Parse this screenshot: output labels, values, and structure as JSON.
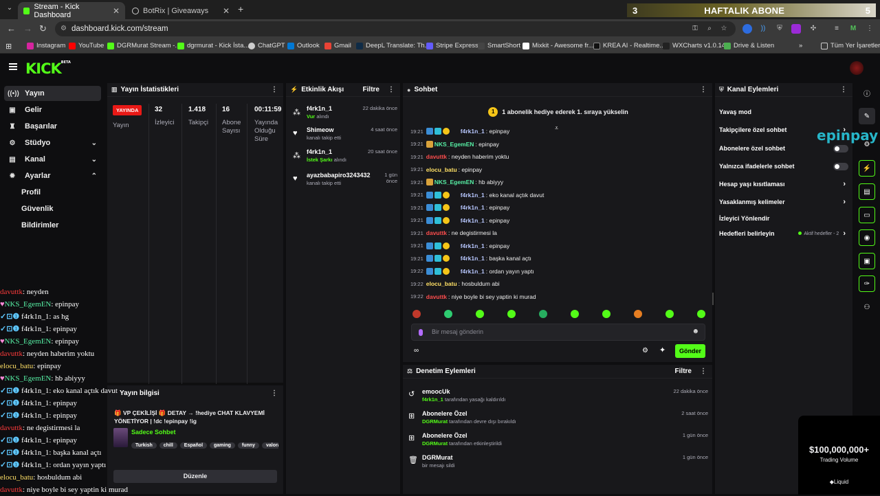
{
  "browser": {
    "tabs": [
      {
        "title": "Stream - Kick Dashboard",
        "active": true
      },
      {
        "title": "BotRix | Giveaways",
        "active": false
      }
    ],
    "url": "dashboard.kick.com/stream",
    "overlay_banner": {
      "left": "3",
      "title": "HAFTALIK ABONE",
      "right": "5"
    },
    "bookmarks": [
      "Instagram",
      "YouTube",
      "DGRMurat Stream -...",
      "dgrmurat - Kick İsta...",
      "ChatGPT",
      "Outlook",
      "Gmail",
      "DeepL Translate: Th...",
      "Stripe Express",
      "SmartShort",
      "Mixkit - Awesome fr...",
      "KREA AI - Realtime...",
      "WXCharts v1.0.14",
      "Drive & Listen"
    ],
    "bookmarks_folder": "Tüm Yer İşaretleri",
    "profile_initial": "M"
  },
  "kick": {
    "logo": "KICK",
    "logo_tag": "BETA"
  },
  "sidebar": {
    "items": [
      {
        "label": "Yayın",
        "icon": "broadcast-icon",
        "selected": true
      },
      {
        "label": "Gelir",
        "icon": "wallet-icon"
      },
      {
        "label": "Başarılar",
        "icon": "trophy-icon"
      },
      {
        "label": "Stüdyo",
        "icon": "studio-icon",
        "chevron": "down"
      },
      {
        "label": "Kanal",
        "icon": "channel-icon",
        "chevron": "down"
      },
      {
        "label": "Ayarlar",
        "icon": "gear-icon",
        "chevron": "up"
      }
    ],
    "sub_items": [
      "Profil",
      "Güvenlik",
      "Bildirimler"
    ]
  },
  "overlay_chat": [
    {
      "user": "davuttk",
      "color": "r",
      "text": "neyden"
    },
    {
      "user": "NKS_EgemEN",
      "color": "p",
      "badge": "heart",
      "text": "epinpay"
    },
    {
      "user": "f4rk1n_1",
      "color": "u",
      "badge": "bd",
      "text": "as hg"
    },
    {
      "user": "f4rk1n_1",
      "color": "u",
      "badge": "bd",
      "text": "epinpay"
    },
    {
      "user": "NKS_EgemEN",
      "color": "p",
      "badge": "heart",
      "text": "epinpay"
    },
    {
      "user": "davuttk",
      "color": "r",
      "text": "neyden haberim yoktu"
    },
    {
      "user": "elocu_batu",
      "color": "y",
      "text": "epinpay"
    },
    {
      "user": "NKS_EgemEN",
      "color": "p",
      "badge": "heart",
      "text": "hb abiyyy"
    },
    {
      "user": "f4rk1n_1",
      "color": "u",
      "badge": "bd",
      "text": "eko kanal açtık davut"
    },
    {
      "user": "f4rk1n_1",
      "color": "u",
      "badge": "bd",
      "text": "epinpay"
    },
    {
      "user": "f4rk1n_1",
      "color": "u",
      "badge": "bd",
      "text": "epinpay"
    },
    {
      "user": "davuttk",
      "color": "r",
      "text": "ne degistirmesi la"
    },
    {
      "user": "f4rk1n_1",
      "color": "u",
      "badge": "bd",
      "text": "epinpay"
    },
    {
      "user": "f4rk1n_1",
      "color": "u",
      "badge": "bd",
      "text": "başka kanal açtı"
    },
    {
      "user": "f4rk1n_1",
      "color": "u",
      "badge": "bd",
      "text": "ordan yayın yaptı"
    },
    {
      "user": "elocu_batu",
      "color": "y",
      "text": "hosbuldum abi"
    },
    {
      "user": "davuttk",
      "color": "r",
      "text": "niye boyle bi sey yaptin ki murad"
    }
  ],
  "stats": {
    "title": "Yayın İstatistikleri",
    "live_label": "YAYINDA",
    "columns": [
      {
        "value": "",
        "label": "Yayın"
      },
      {
        "value": "32",
        "label": "İzleyici"
      },
      {
        "value": "1.418",
        "label": "Takipçi"
      },
      {
        "value": "16",
        "label": "Abone Sayısı"
      },
      {
        "value": "00:11:59",
        "label": "Yayında Olduğu Süre"
      }
    ]
  },
  "stream_info": {
    "title": "Yayın bilgisi",
    "stream_title": "🎁 VP ÇEKİLİŞİ 🎁 DETAY → !hediye CHAT KLAVYEMİ YÖNETİYOR | !dc !epinpay !ig",
    "mode": "Sadece Sohbet",
    "tags": [
      "Turkish",
      "chill",
      "Español",
      "gaming",
      "funny",
      "valorant"
    ],
    "edit_button": "Düzenle"
  },
  "events": {
    "title": "Etkinlik Akışı",
    "filter": "Filtre",
    "items": [
      {
        "user": "f4rk1n_1",
        "highlight": "Vur",
        "desc": " alındı",
        "time": "22 dakika önce",
        "icon": "gift-icon"
      },
      {
        "user": "Shimeow",
        "highlight": "",
        "desc": "kanalı takip etti",
        "time": "4 saat önce",
        "icon": "heart-icon"
      },
      {
        "user": "f4rk1n_1",
        "highlight": "İstek Şarkı",
        "desc": " alındı",
        "time": "20 saat önce",
        "icon": "gift-icon"
      },
      {
        "user": "ayazbabapiro3243432",
        "highlight": "",
        "desc": "kanalı takip etti",
        "time": "1 gün önce",
        "icon": "heart-icon"
      }
    ]
  },
  "chat": {
    "title": "Sohbet",
    "banner": "1 abonelik hediye ederek 1. sıraya yükselin",
    "banner_rank": "1",
    "messages": [
      {
        "time": "19:21",
        "user": "f4rk1n_1",
        "color": "#b8c7ff",
        "badges": [
          "b1",
          "b2",
          "b3"
        ],
        "text": "epinpay"
      },
      {
        "time": "19:21",
        "user": "NKS_EgemEN",
        "color": "#57f0a5",
        "badges": [
          "b4"
        ],
        "text": "epinpay"
      },
      {
        "time": "19:21",
        "user": "davuttk",
        "color": "#ff4d4d",
        "badges": [],
        "text": "neyden haberim yoktu"
      },
      {
        "time": "19:21",
        "user": "elocu_batu",
        "color": "#ffe066",
        "badges": [],
        "text": "epinpay"
      },
      {
        "time": "19:21",
        "user": "NKS_EgemEN",
        "color": "#57f0a5",
        "badges": [
          "b4"
        ],
        "text": "hb abiyyy"
      },
      {
        "time": "19:21",
        "user": "f4rk1n_1",
        "color": "#b8c7ff",
        "badges": [
          "b1",
          "b2",
          "b3"
        ],
        "text": "eko kanal açtık davut"
      },
      {
        "time": "19:21",
        "user": "f4rk1n_1",
        "color": "#b8c7ff",
        "badges": [
          "b1",
          "b2",
          "b3"
        ],
        "text": "epinpay"
      },
      {
        "time": "19:21",
        "user": "f4rk1n_1",
        "color": "#b8c7ff",
        "badges": [
          "b1",
          "b2",
          "b3"
        ],
        "text": "epinpay"
      },
      {
        "time": "19:21",
        "user": "davuttk",
        "color": "#ff4d4d",
        "badges": [],
        "text": "ne degistirmesi la"
      },
      {
        "time": "19:21",
        "user": "f4rk1n_1",
        "color": "#b8c7ff",
        "badges": [
          "b1",
          "b2",
          "b3"
        ],
        "text": "epinpay"
      },
      {
        "time": "19:21",
        "user": "f4rk1n_1",
        "color": "#b8c7ff",
        "badges": [
          "b1",
          "b2",
          "b3"
        ],
        "text": "başka kanal açtı"
      },
      {
        "time": "19:22",
        "user": "f4rk1n_1",
        "color": "#b8c7ff",
        "badges": [
          "b1",
          "b2",
          "b3"
        ],
        "text": "ordan yayın yaptı"
      },
      {
        "time": "19:22",
        "user": "elocu_batu",
        "color": "#ffe066",
        "badges": [],
        "text": "hosbuldum abi"
      },
      {
        "time": "19:22",
        "user": "davuttk",
        "color": "#ff4d4d",
        "badges": [],
        "text": "niye boyle bi sey yaptin ki murad"
      }
    ],
    "input_placeholder": "Bir mesaj gönderin",
    "send_label": "Gönder",
    "emote_colors": [
      "#c0392b",
      "#2ecc71",
      "#53fc18",
      "#53fc18",
      "#27ae60",
      "#53fc18",
      "#53fc18",
      "#e67e22",
      "#53fc18",
      "#53fc18"
    ]
  },
  "moderation": {
    "title": "Denetim Eylemleri",
    "filter": "Filtre",
    "items": [
      {
        "name": "emoocUk",
        "actor": "f4rk1n_1",
        "desc": " tarafından yasağı kaldırıldı",
        "time": "22 dakika önce",
        "icon": "unban-icon"
      },
      {
        "name": "Abonelere Özel",
        "actor": "DGRMurat",
        "desc": " tarafından devre dışı bırakıldı",
        "time": "2 saat önce",
        "icon": "gift-icon"
      },
      {
        "name": "Abonelere Özel",
        "actor": "DGRMurat",
        "desc": " tarafından etkinleştirildi",
        "time": "1 gün önce",
        "icon": "gift-icon"
      },
      {
        "name": "DGRMurat",
        "actor": "",
        "desc": "bir mesajı sildi",
        "time": "1 gün önce",
        "icon": "trash-icon"
      }
    ]
  },
  "channel_actions": {
    "title": "Kanal Eylemleri",
    "items": [
      {
        "label": "Yavaş mod",
        "control": "toggle"
      },
      {
        "label": "Takipçilere özel sohbet",
        "control": "arrow"
      },
      {
        "label": "Abonelere özel sohbet",
        "control": "toggle"
      },
      {
        "label": "Yalnızca ifadelerle sohbet",
        "control": "toggle"
      },
      {
        "label": "Hesap yaşı kısıtlaması",
        "control": "arrow"
      },
      {
        "label": "Yasaklanmış kelimeler",
        "control": "arrow"
      },
      {
        "label": "İzleyici Yönlendir",
        "control": "none"
      },
      {
        "label": "Hedefleri belirleyin",
        "control": "status",
        "status": "Aktif hedefler - 2"
      }
    ],
    "sponsor": "epinpay"
  },
  "ad": {
    "amount": "$100,000,000+",
    "caption": "Trading Volume",
    "brand": "Liquid"
  }
}
